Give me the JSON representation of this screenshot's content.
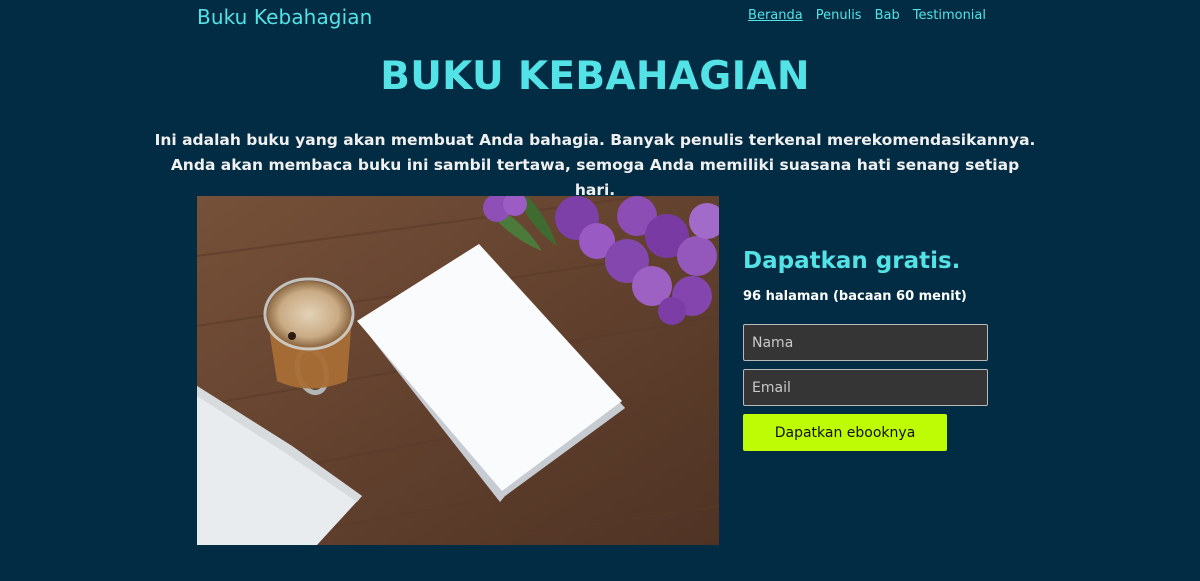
{
  "nav": {
    "brand": "Buku Kebahagian",
    "links": [
      {
        "label": "Beranda",
        "active": true
      },
      {
        "label": "Penulis",
        "active": false
      },
      {
        "label": "Bab",
        "active": false
      },
      {
        "label": "Testimonial",
        "active": false
      }
    ]
  },
  "hero": {
    "title": "BUKU KEBAHAGIAN",
    "description": "Ini adalah buku yang akan membuat Anda bahagia. Banyak penulis terkenal merekomendasikannya. Anda akan membaca buku ini sambil tertawa, semoga Anda memiliki suasana hati senang setiap hari."
  },
  "signup": {
    "heading": "Dapatkan gratis.",
    "info": "96 halaman (bacaan 60 menit)",
    "name_placeholder": "Nama",
    "email_placeholder": "Email",
    "button_label": "Dapatkan ebooknya"
  },
  "colors": {
    "background": "#022c43",
    "accent": "#53e3e6",
    "button": "#bdfc04"
  }
}
